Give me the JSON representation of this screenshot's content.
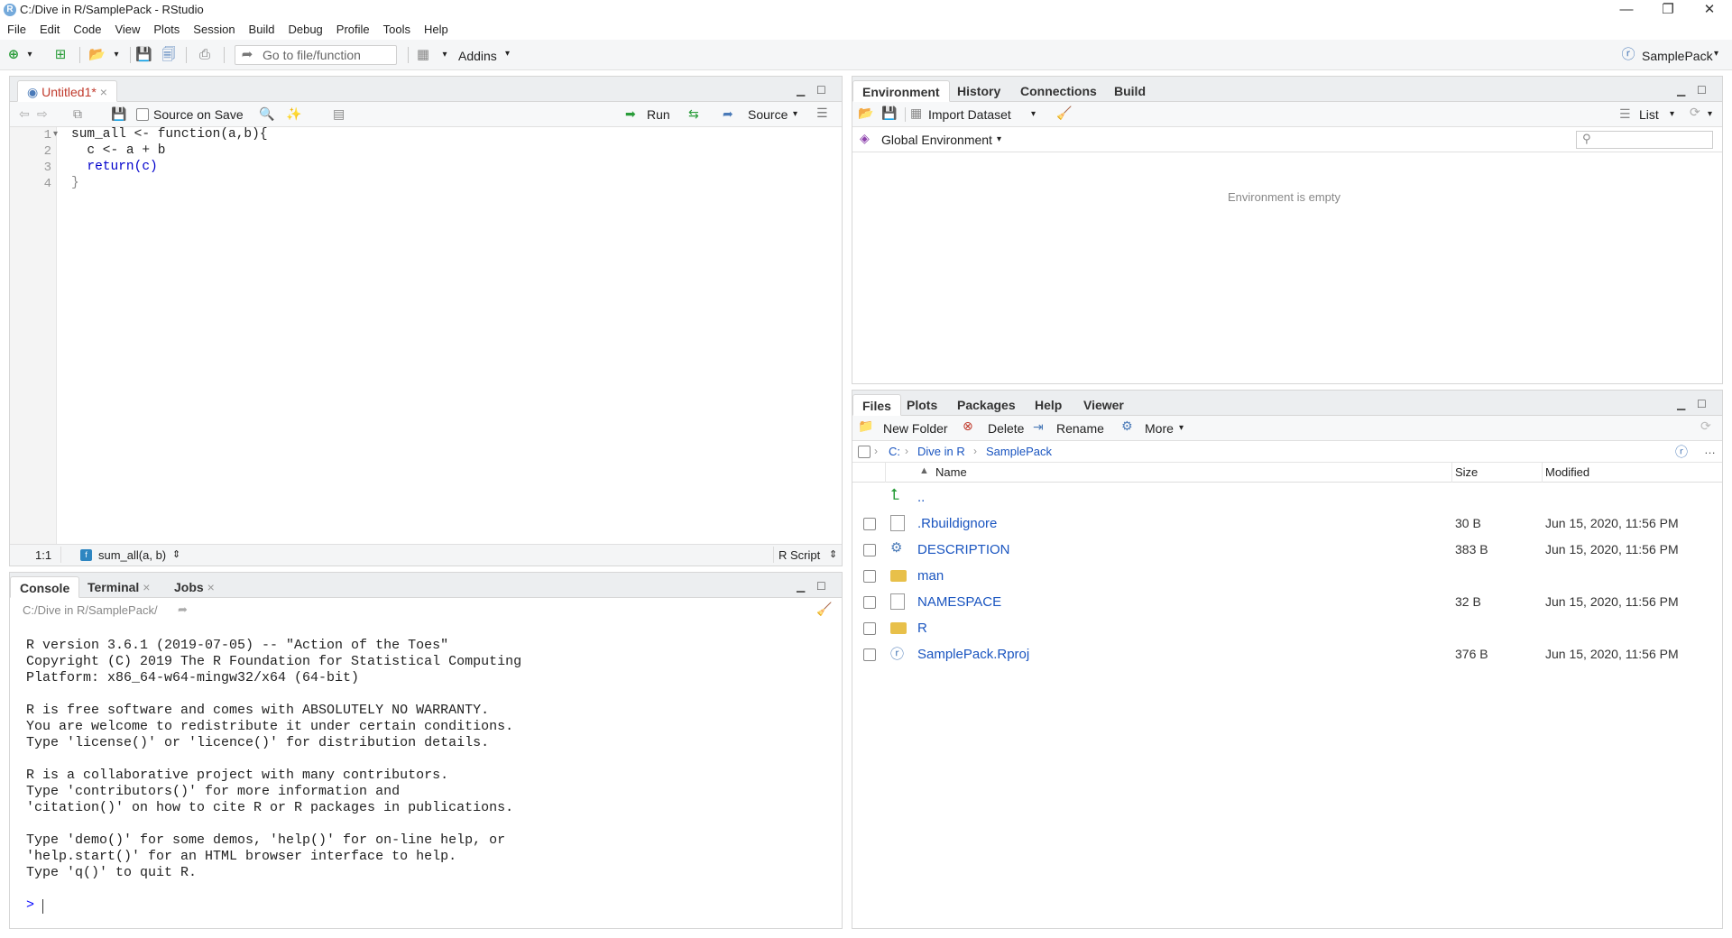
{
  "window": {
    "title": "C:/Dive in R/SamplePack - RStudio",
    "min": "—",
    "max": "❐",
    "close": "✕"
  },
  "menu": [
    "File",
    "Edit",
    "Code",
    "View",
    "Plots",
    "Session",
    "Build",
    "Debug",
    "Profile",
    "Tools",
    "Help"
  ],
  "toolbar": {
    "goto_placeholder": "Go to file/function",
    "addins": "Addins",
    "project": "SamplePack"
  },
  "editor": {
    "tab": "Untitled1*",
    "source_on_save": "Source on Save",
    "run": "Run",
    "source": "Source",
    "lines": [
      "1",
      "2",
      "3",
      "4"
    ],
    "code": [
      "sum_all <- function(a,b){",
      "  c <- a + b",
      "  return(c)",
      "}"
    ],
    "status_pos": "1:1",
    "status_fn": "sum_all(a, b)",
    "status_type": "R Script"
  },
  "console": {
    "tabs": [
      "Console",
      "Terminal",
      "Jobs"
    ],
    "path": "C:/Dive in R/SamplePack/",
    "lines": [
      "R version 3.6.1 (2019-07-05) -- \"Action of the Toes\"",
      "Copyright (C) 2019 The R Foundation for Statistical Computing",
      "Platform: x86_64-w64-mingw32/x64 (64-bit)",
      "",
      "R is free software and comes with ABSOLUTELY NO WARRANTY.",
      "You are welcome to redistribute it under certain conditions.",
      "Type 'license()' or 'licence()' for distribution details.",
      "",
      "R is a collaborative project with many contributors.",
      "Type 'contributors()' for more information and",
      "'citation()' on how to cite R or R packages in publications.",
      "",
      "Type 'demo()' for some demos, 'help()' for on-line help, or",
      "'help.start()' for an HTML browser interface to help.",
      "Type 'q()' to quit R."
    ],
    "prompt": ">"
  },
  "env": {
    "tabs": [
      "Environment",
      "History",
      "Connections",
      "Build"
    ],
    "import": "Import Dataset",
    "list": "List",
    "global": "Global Environment",
    "empty": "Environment is empty"
  },
  "files": {
    "tabs": [
      "Files",
      "Plots",
      "Packages",
      "Help",
      "Viewer"
    ],
    "new_folder": "New Folder",
    "delete": "Delete",
    "rename": "Rename",
    "more": "More",
    "crumbs": [
      "C:",
      "Dive in R",
      "SamplePack"
    ],
    "cols": {
      "name": "Name",
      "size": "Size",
      "modified": "Modified"
    },
    "up": "..",
    "rows": [
      {
        "name": ".Rbuildignore",
        "size": "30 B",
        "modified": "Jun 15, 2020, 11:56 PM",
        "icon": "doc"
      },
      {
        "name": "DESCRIPTION",
        "size": "383 B",
        "modified": "Jun 15, 2020, 11:56 PM",
        "icon": "gear"
      },
      {
        "name": "man",
        "size": "",
        "modified": "",
        "icon": "folder"
      },
      {
        "name": "NAMESPACE",
        "size": "32 B",
        "modified": "Jun 15, 2020, 11:56 PM",
        "icon": "doc"
      },
      {
        "name": "R",
        "size": "",
        "modified": "",
        "icon": "folder"
      },
      {
        "name": "SamplePack.Rproj",
        "size": "376 B",
        "modified": "Jun 15, 2020, 11:56 PM",
        "icon": "rproj"
      }
    ]
  }
}
